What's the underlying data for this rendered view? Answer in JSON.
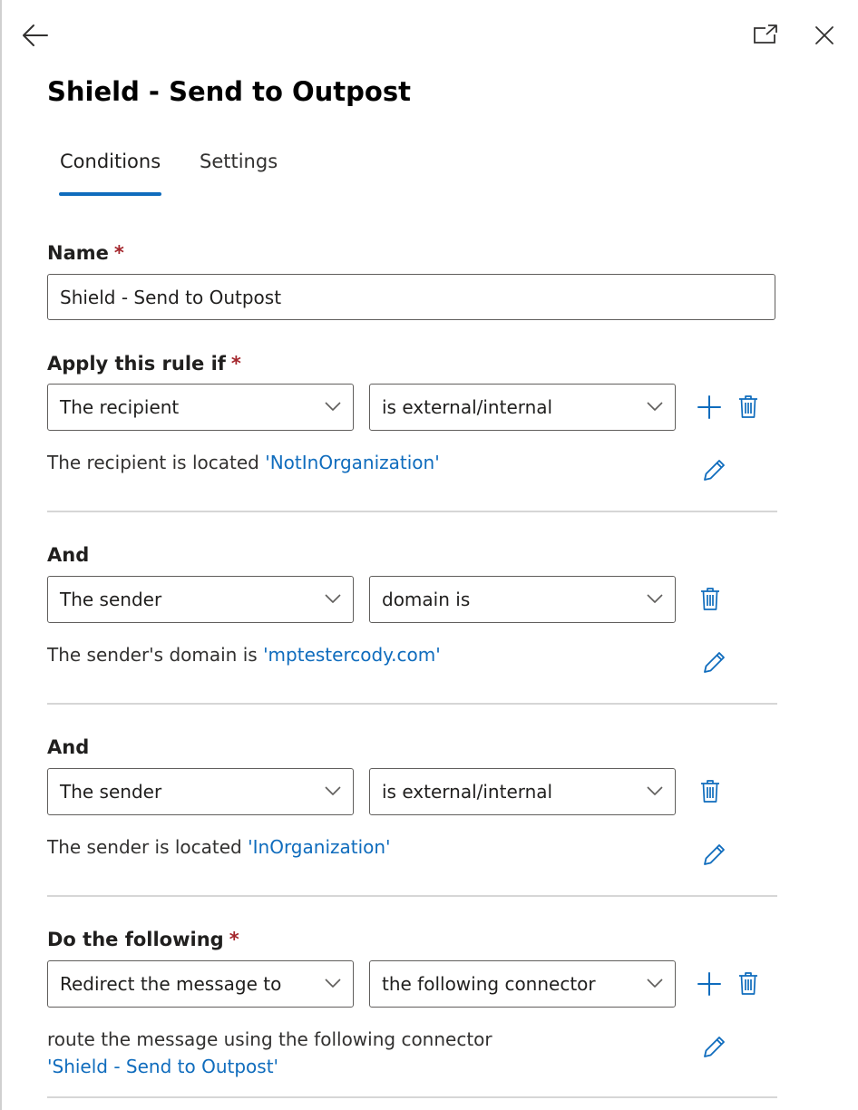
{
  "panel": {
    "title": "Shield - Send to Outpost",
    "tabs": [
      {
        "label": "Conditions",
        "active": true
      },
      {
        "label": "Settings",
        "active": false
      }
    ]
  },
  "name_field": {
    "label": "Name",
    "required_mark": "*",
    "value": "Shield - Send to Outpost"
  },
  "conditions": [
    {
      "label": "Apply this rule if",
      "required_mark": "*",
      "left_select": "The recipient",
      "right_select": "is external/internal",
      "description": "The recipient is located",
      "value_link": "'NotInOrganization'",
      "has_add": true
    },
    {
      "label": "And",
      "left_select": "The sender",
      "right_select": "domain is",
      "description": "The sender's domain is",
      "value_link": "'mptestercody.com'",
      "has_add": false
    },
    {
      "label": "And",
      "left_select": "The sender",
      "right_select": "is external/internal",
      "description": "The sender is located",
      "value_link": "'InOrganization'",
      "has_add": false
    }
  ],
  "action": {
    "label": "Do the following",
    "required_mark": "*",
    "left_select": "Redirect the message to",
    "right_select": "the following connector",
    "description": "route the message using the following connector",
    "value_link": "'Shield - Send to Outpost'",
    "has_add": true
  },
  "colors": {
    "accent": "#0f6cbd",
    "required": "#a4262c",
    "divider": "#d6d6d6"
  },
  "icons": [
    "back-arrow-icon",
    "popout-icon",
    "close-icon",
    "chevron-down-icon",
    "add-icon",
    "delete-icon",
    "edit-icon"
  ]
}
